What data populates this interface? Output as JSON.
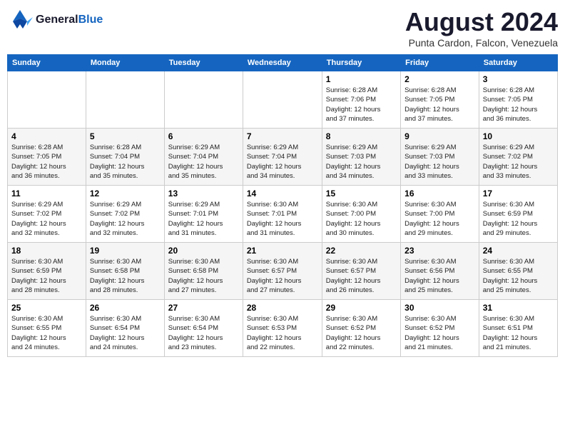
{
  "header": {
    "logo_line1": "General",
    "logo_line2": "Blue",
    "month": "August 2024",
    "location": "Punta Cardon, Falcon, Venezuela"
  },
  "days_of_week": [
    "Sunday",
    "Monday",
    "Tuesday",
    "Wednesday",
    "Thursday",
    "Friday",
    "Saturday"
  ],
  "weeks": [
    [
      {
        "num": "",
        "info": ""
      },
      {
        "num": "",
        "info": ""
      },
      {
        "num": "",
        "info": ""
      },
      {
        "num": "",
        "info": ""
      },
      {
        "num": "1",
        "info": "Sunrise: 6:28 AM\nSunset: 7:06 PM\nDaylight: 12 hours\nand 37 minutes."
      },
      {
        "num": "2",
        "info": "Sunrise: 6:28 AM\nSunset: 7:05 PM\nDaylight: 12 hours\nand 37 minutes."
      },
      {
        "num": "3",
        "info": "Sunrise: 6:28 AM\nSunset: 7:05 PM\nDaylight: 12 hours\nand 36 minutes."
      }
    ],
    [
      {
        "num": "4",
        "info": "Sunrise: 6:28 AM\nSunset: 7:05 PM\nDaylight: 12 hours\nand 36 minutes."
      },
      {
        "num": "5",
        "info": "Sunrise: 6:28 AM\nSunset: 7:04 PM\nDaylight: 12 hours\nand 35 minutes."
      },
      {
        "num": "6",
        "info": "Sunrise: 6:29 AM\nSunset: 7:04 PM\nDaylight: 12 hours\nand 35 minutes."
      },
      {
        "num": "7",
        "info": "Sunrise: 6:29 AM\nSunset: 7:04 PM\nDaylight: 12 hours\nand 34 minutes."
      },
      {
        "num": "8",
        "info": "Sunrise: 6:29 AM\nSunset: 7:03 PM\nDaylight: 12 hours\nand 34 minutes."
      },
      {
        "num": "9",
        "info": "Sunrise: 6:29 AM\nSunset: 7:03 PM\nDaylight: 12 hours\nand 33 minutes."
      },
      {
        "num": "10",
        "info": "Sunrise: 6:29 AM\nSunset: 7:02 PM\nDaylight: 12 hours\nand 33 minutes."
      }
    ],
    [
      {
        "num": "11",
        "info": "Sunrise: 6:29 AM\nSunset: 7:02 PM\nDaylight: 12 hours\nand 32 minutes."
      },
      {
        "num": "12",
        "info": "Sunrise: 6:29 AM\nSunset: 7:02 PM\nDaylight: 12 hours\nand 32 minutes."
      },
      {
        "num": "13",
        "info": "Sunrise: 6:29 AM\nSunset: 7:01 PM\nDaylight: 12 hours\nand 31 minutes."
      },
      {
        "num": "14",
        "info": "Sunrise: 6:30 AM\nSunset: 7:01 PM\nDaylight: 12 hours\nand 31 minutes."
      },
      {
        "num": "15",
        "info": "Sunrise: 6:30 AM\nSunset: 7:00 PM\nDaylight: 12 hours\nand 30 minutes."
      },
      {
        "num": "16",
        "info": "Sunrise: 6:30 AM\nSunset: 7:00 PM\nDaylight: 12 hours\nand 29 minutes."
      },
      {
        "num": "17",
        "info": "Sunrise: 6:30 AM\nSunset: 6:59 PM\nDaylight: 12 hours\nand 29 minutes."
      }
    ],
    [
      {
        "num": "18",
        "info": "Sunrise: 6:30 AM\nSunset: 6:59 PM\nDaylight: 12 hours\nand 28 minutes."
      },
      {
        "num": "19",
        "info": "Sunrise: 6:30 AM\nSunset: 6:58 PM\nDaylight: 12 hours\nand 28 minutes."
      },
      {
        "num": "20",
        "info": "Sunrise: 6:30 AM\nSunset: 6:58 PM\nDaylight: 12 hours\nand 27 minutes."
      },
      {
        "num": "21",
        "info": "Sunrise: 6:30 AM\nSunset: 6:57 PM\nDaylight: 12 hours\nand 27 minutes."
      },
      {
        "num": "22",
        "info": "Sunrise: 6:30 AM\nSunset: 6:57 PM\nDaylight: 12 hours\nand 26 minutes."
      },
      {
        "num": "23",
        "info": "Sunrise: 6:30 AM\nSunset: 6:56 PM\nDaylight: 12 hours\nand 25 minutes."
      },
      {
        "num": "24",
        "info": "Sunrise: 6:30 AM\nSunset: 6:55 PM\nDaylight: 12 hours\nand 25 minutes."
      }
    ],
    [
      {
        "num": "25",
        "info": "Sunrise: 6:30 AM\nSunset: 6:55 PM\nDaylight: 12 hours\nand 24 minutes."
      },
      {
        "num": "26",
        "info": "Sunrise: 6:30 AM\nSunset: 6:54 PM\nDaylight: 12 hours\nand 24 minutes."
      },
      {
        "num": "27",
        "info": "Sunrise: 6:30 AM\nSunset: 6:54 PM\nDaylight: 12 hours\nand 23 minutes."
      },
      {
        "num": "28",
        "info": "Sunrise: 6:30 AM\nSunset: 6:53 PM\nDaylight: 12 hours\nand 22 minutes."
      },
      {
        "num": "29",
        "info": "Sunrise: 6:30 AM\nSunset: 6:52 PM\nDaylight: 12 hours\nand 22 minutes."
      },
      {
        "num": "30",
        "info": "Sunrise: 6:30 AM\nSunset: 6:52 PM\nDaylight: 12 hours\nand 21 minutes."
      },
      {
        "num": "31",
        "info": "Sunrise: 6:30 AM\nSunset: 6:51 PM\nDaylight: 12 hours\nand 21 minutes."
      }
    ]
  ]
}
